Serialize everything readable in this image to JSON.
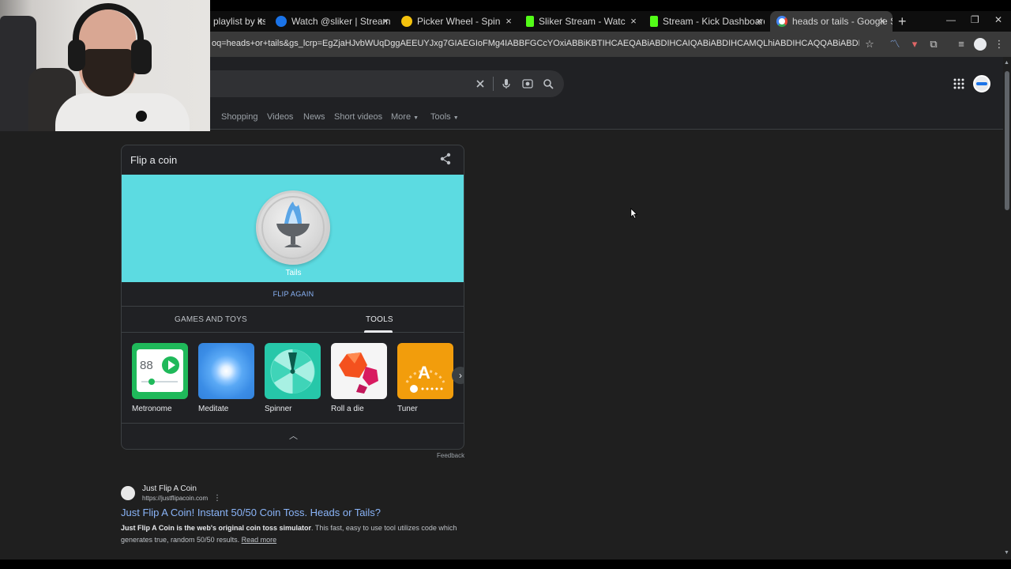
{
  "tabs": [
    {
      "title": "playlist by its",
      "fav_color": "#d33"
    },
    {
      "title": "Watch @sliker | Streamable",
      "fav_color": "#1a73e8"
    },
    {
      "title": "Picker Wheel - Spin the Wheel t",
      "fav_color": "#f4c20d"
    },
    {
      "title": "Sliker Stream - Watch Live on K",
      "fav_color": "#53fc18"
    },
    {
      "title": "Stream - Kick Dashboard",
      "fav_color": "#53fc18"
    },
    {
      "title": "heads or tails - Google Search",
      "fav_color": "#ffffff"
    }
  ],
  "tab_close_glyph": "×",
  "new_tab_glyph": "+",
  "window_controls": {
    "minimize": "—",
    "restore": "❐",
    "close": "✕"
  },
  "address_bar": {
    "url": "oq=heads+or+tails&gs_lcrp=EgZjaHJvbWUqDggAEEUYJxg7GIAEGIoFMg4IABBFGCcYOxiABBiKBTIHCAEQABiABDIHCAIQABiABDIHCAMQLhiABDIHCAQQABiABDIHCAUQABiABDIHCAYQABiABDIHCA..."
  },
  "search": {
    "filters": [
      "Shopping",
      "Videos",
      "News",
      "Short videos",
      "More",
      "Tools"
    ]
  },
  "coin_card": {
    "title": "Flip a coin",
    "result": "Tails",
    "flip_again": "FLIP AGAIN",
    "tab_games": "GAMES AND TOYS",
    "tab_tools": "TOOLS",
    "metronome_value": "88",
    "tools": [
      {
        "label": "Metronome"
      },
      {
        "label": "Meditate"
      },
      {
        "label": "Spinner"
      },
      {
        "label": "Roll a die"
      },
      {
        "label": "Tuner"
      }
    ],
    "feedback": "Feedback"
  },
  "result": {
    "site_name": "Just Flip A Coin",
    "site_url": "https://justflipacoin.com",
    "title": "Just Flip A Coin! Instant 50/50 Coin Toss. Heads or Tails?",
    "snippet_bold": "Just Flip A Coin is the web's original coin toss simulator",
    "snippet_rest": ". This fast, easy to use tool utilizes code which generates true, random 50/50 results.",
    "read_more": "Read more"
  },
  "tuner_letter": "A",
  "colors": {
    "accent_link": "#8ab4f8",
    "coin_bg": "#5cdbe1",
    "page_bg": "#1f1f1f"
  }
}
